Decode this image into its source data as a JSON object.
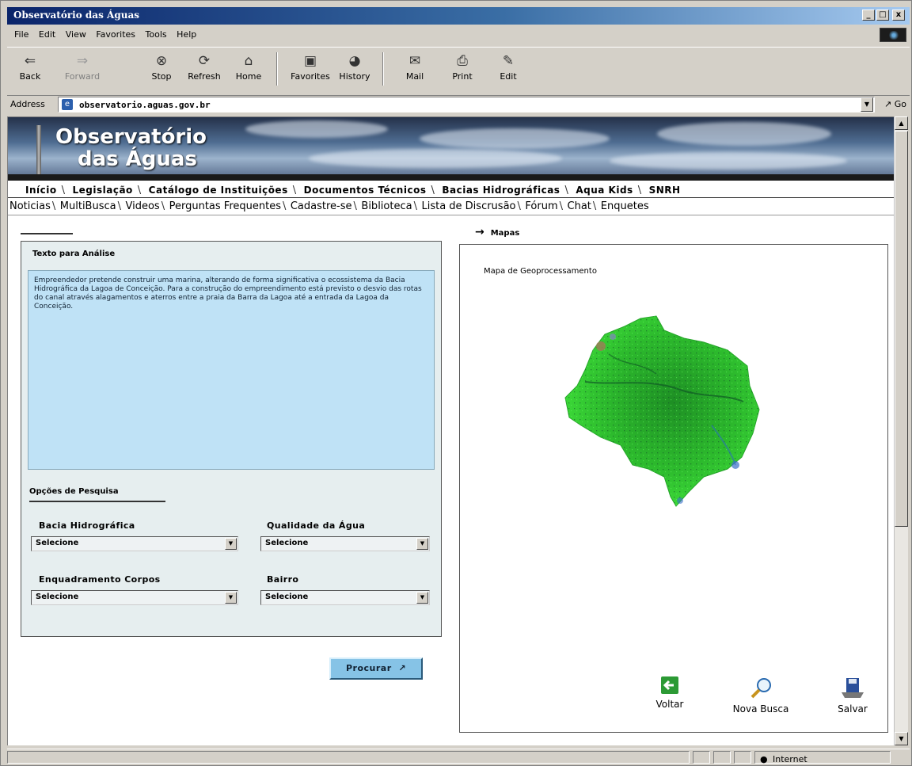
{
  "window": {
    "title": "Observatório das Águas",
    "min": "_",
    "max": "□",
    "close": "x"
  },
  "menu": [
    "File",
    "Edit",
    "View",
    "Favorites",
    "Tools",
    "Help"
  ],
  "toolbar": [
    {
      "label": "Back",
      "icon": "back-arrow-icon",
      "glyph": "⇐"
    },
    {
      "label": "Forward",
      "icon": "forward-arrow-icon",
      "glyph": "⇒"
    },
    {
      "label": "Stop",
      "icon": "stop-icon",
      "glyph": "⊗"
    },
    {
      "label": "Refresh",
      "icon": "refresh-icon",
      "glyph": "⟳"
    },
    {
      "label": "Home",
      "icon": "home-icon",
      "glyph": "⌂"
    },
    {
      "label": "Favorites",
      "icon": "favorites-icon",
      "glyph": "▣"
    },
    {
      "label": "History",
      "icon": "history-icon",
      "glyph": "◕"
    },
    {
      "label": "Mail",
      "icon": "mail-icon",
      "glyph": "✉"
    },
    {
      "label": "Print",
      "icon": "print-icon",
      "glyph": "⎙"
    },
    {
      "label": "Edit",
      "icon": "edit-icon",
      "glyph": "✎"
    }
  ],
  "address": {
    "label": "Address",
    "url": "observatorio.aguas.gov.br",
    "go": "Go"
  },
  "banner": {
    "line1": "Observatório",
    "line2": "das Águas"
  },
  "nav_primary": [
    "Início",
    "Legislação",
    "Catálogo de Instituições",
    "Documentos Técnicos",
    "Bacias Hidrográficas",
    "Aqua Kids",
    "SNRH"
  ],
  "nav_secondary": [
    "Noticias",
    "MultiBusca",
    "Videos",
    "Perguntas Frequentes",
    "Cadastre-se",
    "Biblioteca",
    "Lista de Discrusão",
    "Fórum",
    "Chat",
    "Enquetes"
  ],
  "left": {
    "title": "Texto para Análise",
    "text": "Empreendedor pretende construir uma marina, alterando de forma significativa o ecossistema da Bacia Hidrográfica da Lagoa de Conceição. Para a construção do empreendimento está previsto o desvio das rotas do canal através alagamentos e aterros entre a praia da Barra da Lagoa até a entrada da Lagoa da Conceição.",
    "options_title": "Opções de Pesquisa",
    "fields": [
      {
        "label": "Bacia Hidrográfica",
        "value": "Selecione"
      },
      {
        "label": "Qualidade da Água",
        "value": "Selecione"
      },
      {
        "label": "Enquadramento Corpos",
        "value": "Selecione"
      },
      {
        "label": "Bairro",
        "value": "Selecione"
      }
    ],
    "search_button": "Procurar"
  },
  "maps": {
    "header": "Mapas",
    "title": "Mapa de Geoprocessamento",
    "actions": [
      {
        "label": "Voltar",
        "icon": "back-green-icon"
      },
      {
        "label": "Nova Busca",
        "icon": "magnifier-icon"
      },
      {
        "label": "Salvar",
        "icon": "floppy-disk-icon"
      }
    ]
  },
  "status": {
    "zone": "Internet"
  },
  "colors": {
    "titlebar": "#0a246a",
    "panel": "#e6eeef",
    "textbox": "#bfe2f6",
    "map_green": "#2fbf2f",
    "button": "#86c3e6"
  }
}
